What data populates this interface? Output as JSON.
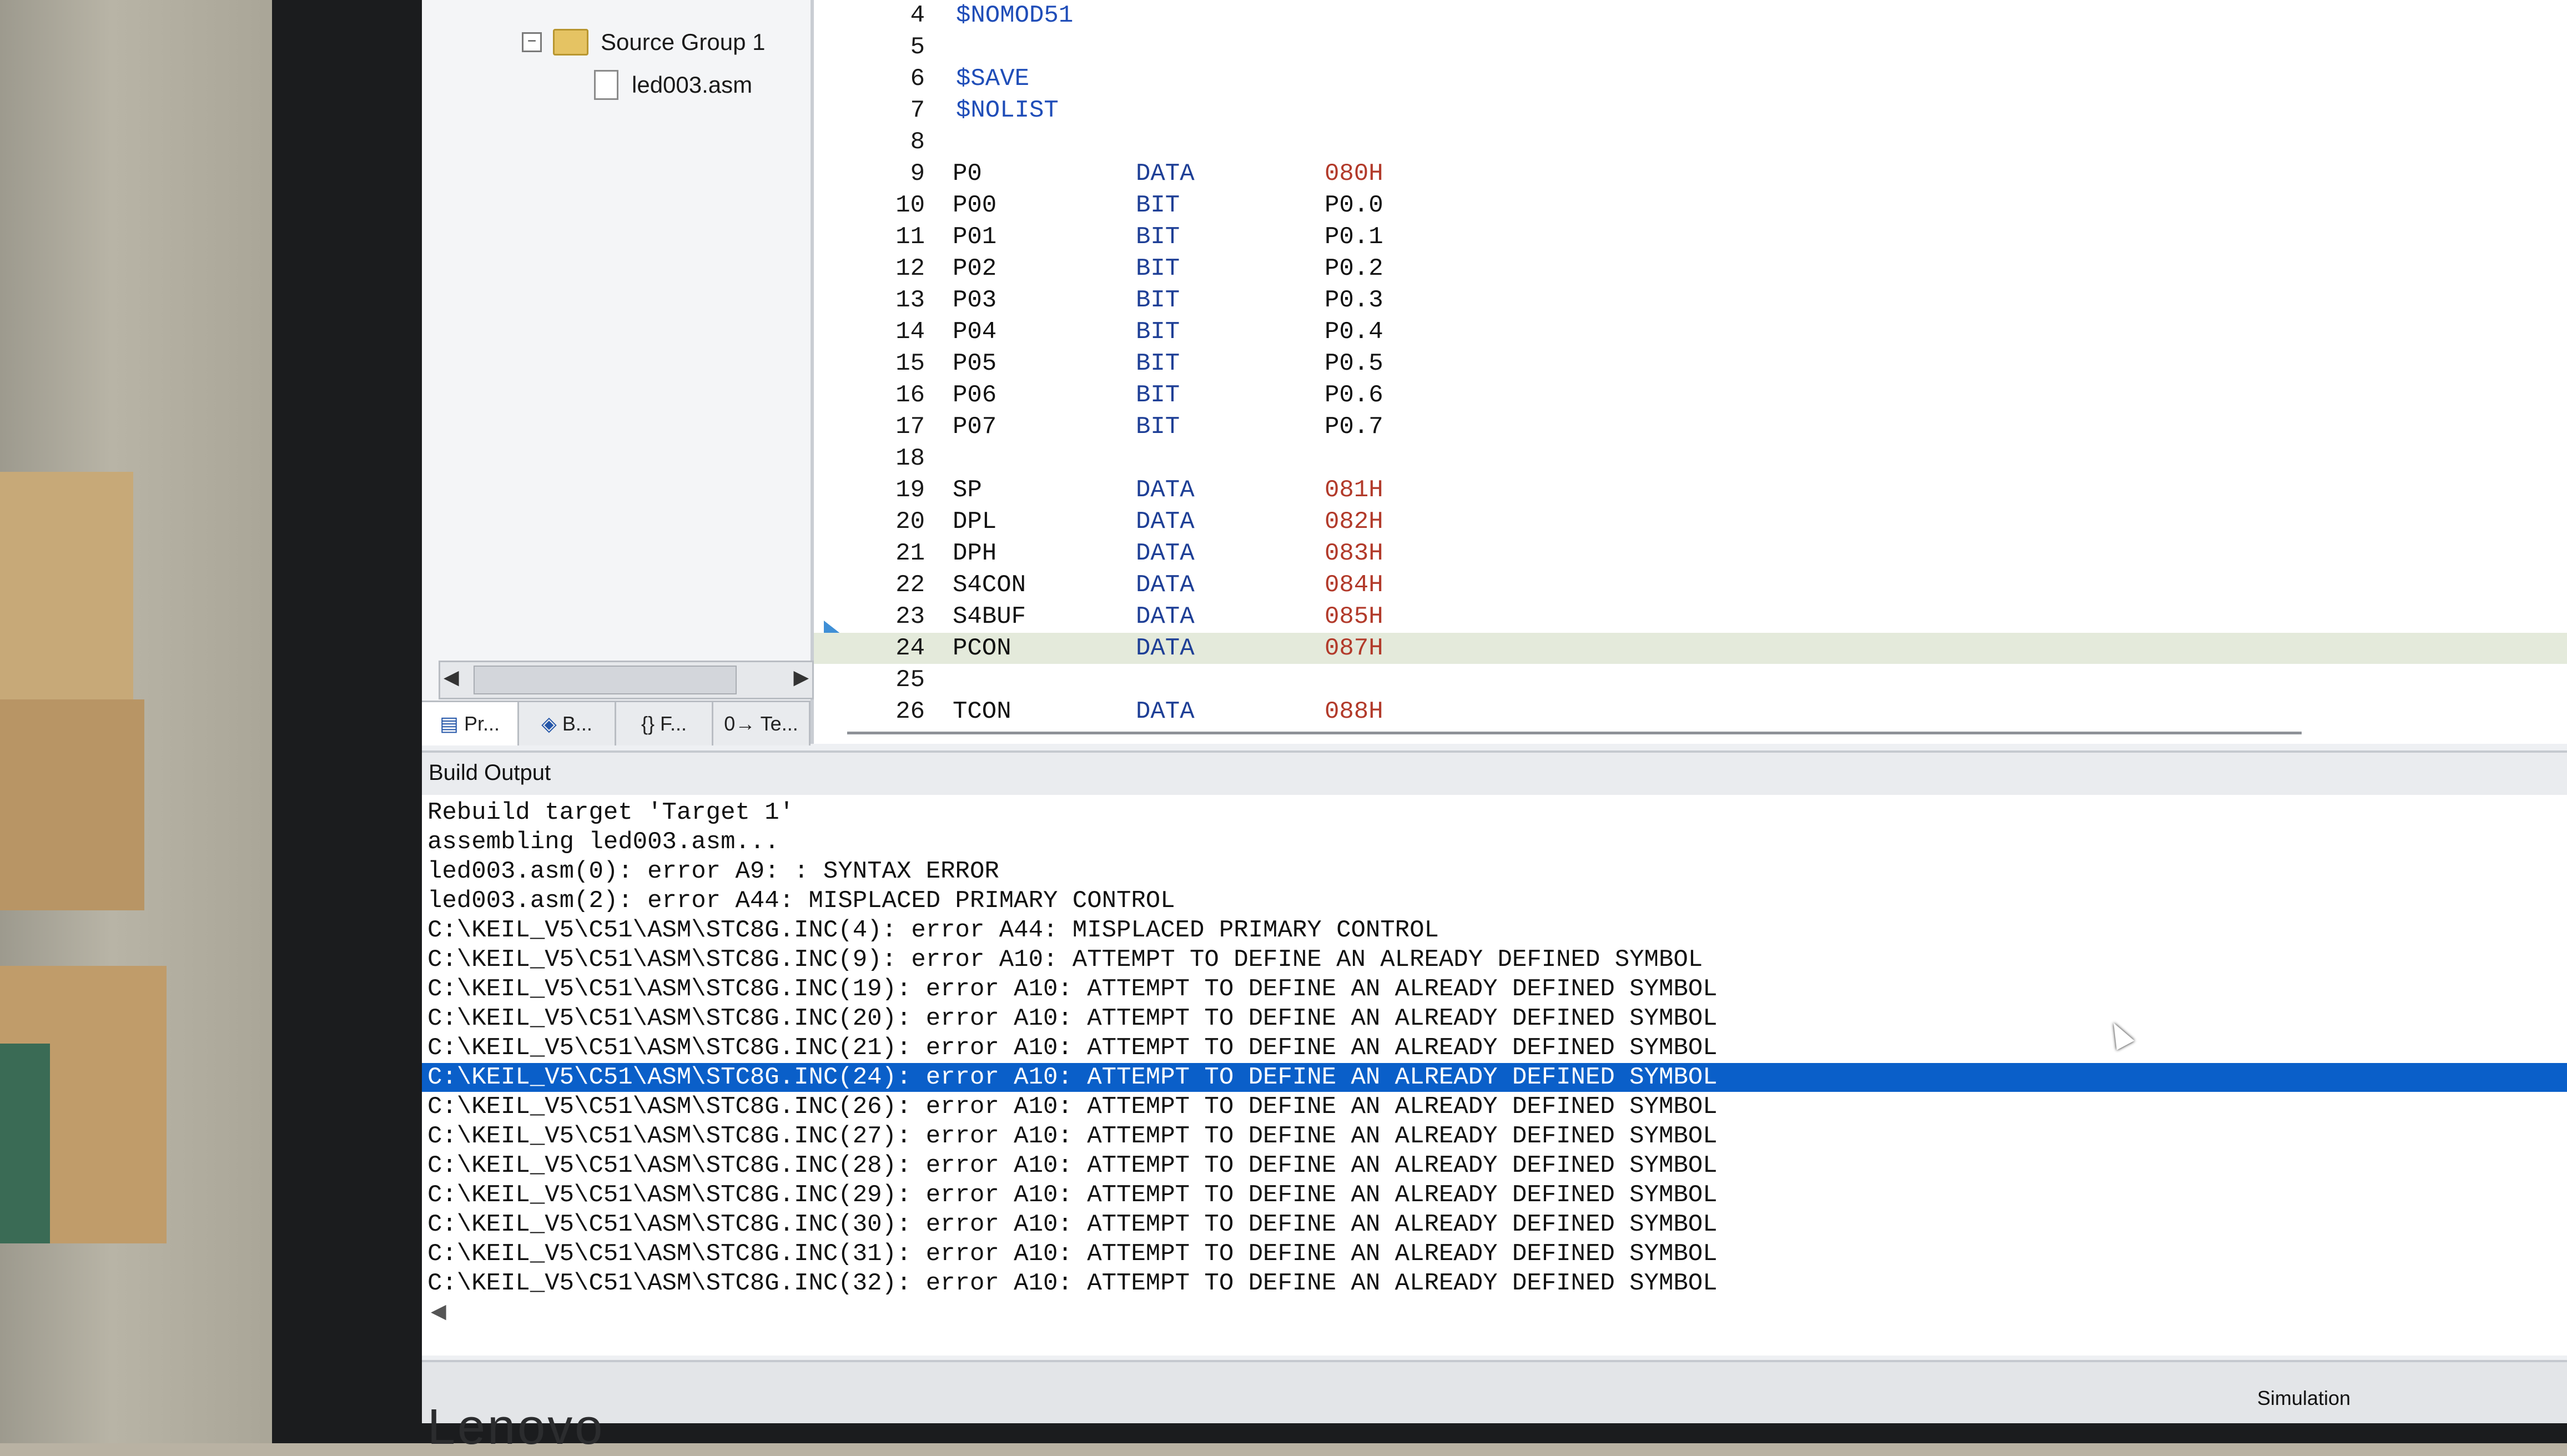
{
  "project_tree": {
    "group_label": "Source Group 1",
    "file_label": "led003.asm"
  },
  "panel_tabs": [
    {
      "label": "Pr...",
      "icon": "project-icon"
    },
    {
      "label": "B...",
      "icon": "books-icon"
    },
    {
      "label": "{} F...",
      "icon": "functions-icon"
    },
    {
      "label": "0→ Te...",
      "icon": "templates-icon"
    }
  ],
  "editor": {
    "lines": [
      {
        "num": "4",
        "text": "$NOMOD51",
        "kind": "ctrl"
      },
      {
        "num": "5",
        "text": "",
        "kind": "blank"
      },
      {
        "num": "6",
        "text": "$SAVE",
        "kind": "ctrl"
      },
      {
        "num": "7",
        "text": "$NOLIST",
        "kind": "ctrl"
      },
      {
        "num": "8",
        "text": "",
        "kind": "blank"
      },
      {
        "num": "9",
        "name": "P0",
        "type": "DATA",
        "value": "080H",
        "kind": "decl"
      },
      {
        "num": "10",
        "name": "P00",
        "type": "BIT",
        "value": "P0.0",
        "kind": "decl"
      },
      {
        "num": "11",
        "name": "P01",
        "type": "BIT",
        "value": "P0.1",
        "kind": "decl"
      },
      {
        "num": "12",
        "name": "P02",
        "type": "BIT",
        "value": "P0.2",
        "kind": "decl"
      },
      {
        "num": "13",
        "name": "P03",
        "type": "BIT",
        "value": "P0.3",
        "kind": "decl"
      },
      {
        "num": "14",
        "name": "P04",
        "type": "BIT",
        "value": "P0.4",
        "kind": "decl"
      },
      {
        "num": "15",
        "name": "P05",
        "type": "BIT",
        "value": "P0.5",
        "kind": "decl"
      },
      {
        "num": "16",
        "name": "P06",
        "type": "BIT",
        "value": "P0.6",
        "kind": "decl"
      },
      {
        "num": "17",
        "name": "P07",
        "type": "BIT",
        "value": "P0.7",
        "kind": "decl"
      },
      {
        "num": "18",
        "text": "",
        "kind": "blank"
      },
      {
        "num": "19",
        "name": "SP",
        "type": "DATA",
        "value": "081H",
        "kind": "decl"
      },
      {
        "num": "20",
        "name": "DPL",
        "type": "DATA",
        "value": "082H",
        "kind": "decl"
      },
      {
        "num": "21",
        "name": "DPH",
        "type": "DATA",
        "value": "083H",
        "kind": "decl"
      },
      {
        "num": "22",
        "name": "S4CON",
        "type": "DATA",
        "value": "084H",
        "kind": "decl"
      },
      {
        "num": "23",
        "name": "S4BUF",
        "type": "DATA",
        "value": "085H",
        "kind": "decl"
      },
      {
        "num": "24",
        "name": "PCON",
        "type": "DATA",
        "value": "087H",
        "kind": "decl",
        "current": true
      },
      {
        "num": "25",
        "text": "",
        "kind": "blank"
      },
      {
        "num": "26",
        "name": "TCON",
        "type": "DATA",
        "value": "088H",
        "kind": "decl"
      }
    ]
  },
  "build_output": {
    "title": "Build Output",
    "lines": [
      "Rebuild target 'Target 1'",
      "assembling led003.asm...",
      "led003.asm(0): error A9: : SYNTAX ERROR",
      "led003.asm(2): error A44: MISPLACED PRIMARY CONTROL",
      "C:\\KEIL_V5\\C51\\ASM\\STC8G.INC(4): error A44: MISPLACED PRIMARY CONTROL",
      "C:\\KEIL_V5\\C51\\ASM\\STC8G.INC(9): error A10: ATTEMPT TO DEFINE AN ALREADY DEFINED SYMBOL",
      "C:\\KEIL_V5\\C51\\ASM\\STC8G.INC(19): error A10: ATTEMPT TO DEFINE AN ALREADY DEFINED SYMBOL",
      "C:\\KEIL_V5\\C51\\ASM\\STC8G.INC(20): error A10: ATTEMPT TO DEFINE AN ALREADY DEFINED SYMBOL",
      "C:\\KEIL_V5\\C51\\ASM\\STC8G.INC(21): error A10: ATTEMPT TO DEFINE AN ALREADY DEFINED SYMBOL",
      "C:\\KEIL_V5\\C51\\ASM\\STC8G.INC(24): error A10: ATTEMPT TO DEFINE AN ALREADY DEFINED SYMBOL",
      "C:\\KEIL_V5\\C51\\ASM\\STC8G.INC(26): error A10: ATTEMPT TO DEFINE AN ALREADY DEFINED SYMBOL",
      "C:\\KEIL_V5\\C51\\ASM\\STC8G.INC(27): error A10: ATTEMPT TO DEFINE AN ALREADY DEFINED SYMBOL",
      "C:\\KEIL_V5\\C51\\ASM\\STC8G.INC(28): error A10: ATTEMPT TO DEFINE AN ALREADY DEFINED SYMBOL",
      "C:\\KEIL_V5\\C51\\ASM\\STC8G.INC(29): error A10: ATTEMPT TO DEFINE AN ALREADY DEFINED SYMBOL",
      "C:\\KEIL_V5\\C51\\ASM\\STC8G.INC(30): error A10: ATTEMPT TO DEFINE AN ALREADY DEFINED SYMBOL",
      "C:\\KEIL_V5\\C51\\ASM\\STC8G.INC(31): error A10: ATTEMPT TO DEFINE AN ALREADY DEFINED SYMBOL",
      "C:\\KEIL_V5\\C51\\ASM\\STC8G.INC(32): error A10: ATTEMPT TO DEFINE AN ALREADY DEFINED SYMBOL"
    ],
    "selected_index": 9
  },
  "status_bar": {
    "mode": "Simulation"
  },
  "colors": {
    "selection": "#0a5fc9",
    "current_line": "#e4eadb",
    "hex_value": "#b23a2a",
    "keyword": "#1e3f96"
  }
}
